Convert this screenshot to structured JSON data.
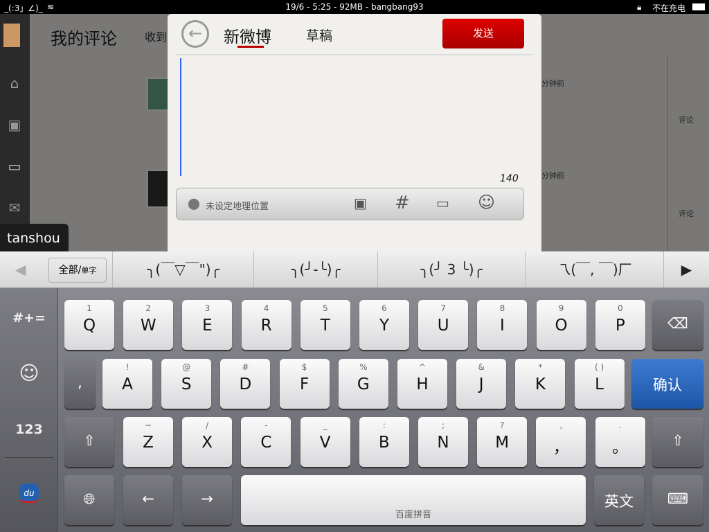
{
  "status": {
    "left": "_(:3」∠)_",
    "center": "19/6 - 5:25 - 92MB - bangbang93",
    "charge": "不在充电"
  },
  "app": {
    "title": "我的评论",
    "tab": "收到",
    "items": [
      {
        "time": "分钟前",
        "action": "评论"
      },
      {
        "time": "分钟前",
        "action": "评论"
      }
    ],
    "tooltip": "tanshou"
  },
  "compose": {
    "tabs": [
      "新微博",
      "草稿"
    ],
    "send": "发送",
    "count": "140",
    "location": "未设定地理位置",
    "tools": [
      "at-icon",
      "hashtag-icon",
      "image-icon",
      "emoji-icon"
    ]
  },
  "candidates": {
    "mode": "全部/",
    "mode_sub": "单字",
    "items": [
      "╮(￣▽￣\")╭",
      "╮(╯-╰)╭",
      "╮(╯ 3 ╰)╭",
      "乁(￣, ￣)厂"
    ]
  },
  "keyboard": {
    "left": [
      "#+=",
      "☺",
      "123"
    ],
    "row1": [
      [
        "1",
        "Q"
      ],
      [
        "2",
        "W"
      ],
      [
        "3",
        "E"
      ],
      [
        "4",
        "R"
      ],
      [
        "5",
        "T"
      ],
      [
        "6",
        "Y"
      ],
      [
        "7",
        "U"
      ],
      [
        "8",
        "I"
      ],
      [
        "9",
        "O"
      ],
      [
        "0",
        "P"
      ]
    ],
    "row2": [
      [
        "!",
        "A"
      ],
      [
        "@",
        "S"
      ],
      [
        "#",
        "D"
      ],
      [
        "$",
        "F"
      ],
      [
        "%",
        "G"
      ],
      [
        "^",
        "H"
      ],
      [
        "&",
        "J"
      ],
      [
        "*",
        "K"
      ],
      [
        "( )",
        "L"
      ]
    ],
    "row3": [
      [
        "~",
        "Z"
      ],
      [
        "/",
        "X"
      ],
      [
        "-",
        "C"
      ],
      [
        "_",
        "V"
      ],
      [
        ":",
        "B"
      ],
      [
        ";",
        "N"
      ],
      [
        "?",
        "M"
      ],
      [
        ",",
        "，"
      ],
      [
        ".",
        "。"
      ]
    ],
    "comma": ",",
    "confirm": "确认",
    "space": "百度拼音",
    "lang": "英文",
    "accent": "#1d56a8",
    "send_color": "#b00000"
  }
}
